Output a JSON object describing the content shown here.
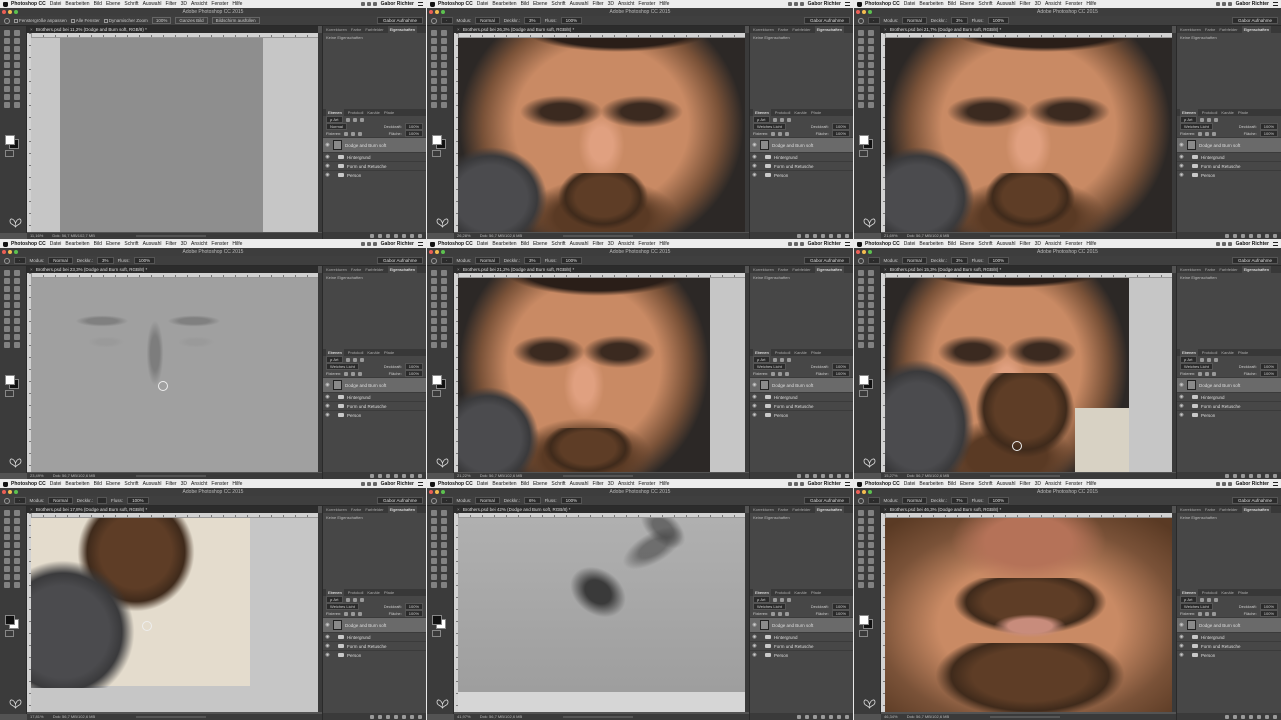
{
  "menubar": {
    "app": "Photoshop CC",
    "items": [
      "Datei",
      "Bearbeiten",
      "Bild",
      "Ebene",
      "Schrift",
      "Auswahl",
      "Filter",
      "3D",
      "Ansicht",
      "Fenster",
      "Hilfe"
    ],
    "user": "Gabor Richter"
  },
  "window_title": "Adobe Photoshop CC 2015",
  "options_move": {
    "fit": "Fenstergröße anpassen",
    "all_windows": "Alle Fenster",
    "scrubby": "Dynamischer Zoom",
    "zoom": "100%",
    "full": "Ganzes Bild",
    "fill": "Bildschirm ausfüllen"
  },
  "options_brush": {
    "mode_label": "Modus:",
    "mode": "Normal",
    "opacity_label": "Deckkr.:",
    "flow_label": "Fluss:",
    "flow": "100%"
  },
  "workspace": "Gabor Aufnahme",
  "panel_tabs": [
    "Korrekturen",
    "Farbe",
    "Farbfelder",
    "Eigenschaften"
  ],
  "properties_empty": "Keine Eigenschaften",
  "layer_tabs": [
    "Ebenen",
    "Protokoll",
    "Kanäle",
    "Pfade"
  ],
  "layer_controls": {
    "kind": "Art",
    "opacity_label": "Deckkraft:",
    "opacity": "100%",
    "lock_label": "Fixieren:",
    "fill_label": "Fläche:",
    "fill": "100%"
  },
  "layers": [
    "Dodge and Burn soft",
    "Hintergrund",
    "Form und Retusche",
    "Person"
  ],
  "panes": [
    {
      "doc": "Brothers.psd bei 11,2% (Dodge and Burn soft, RGB/8) *",
      "zoom": "11,16%",
      "blend": "Normal",
      "opacity": "",
      "doc_info": "Dok: 56,7 MB/102,7 MB"
    },
    {
      "doc": "Brothers.psd bei 26,3% (Dodge and Burn soft, RGB/8) *",
      "zoom": "26,28%",
      "blend": "Weiches Licht",
      "opacity": "3%",
      "doc_info": "Dok: 56,7 MB/102,6 MB"
    },
    {
      "doc": "Brothers.psd bei 21,7% (Dodge and Burn soft, RGB/8) *",
      "zoom": "21,69%",
      "blend": "Weiches Licht",
      "opacity": "3%",
      "doc_info": "Dok: 56,7 MB/102,6 MB"
    },
    {
      "doc": "Brothers.psd bei 23,3% (Dodge and Burn soft, RGB/8) *",
      "zoom": "23,49%",
      "blend": "Weiches Licht",
      "opacity": "3%",
      "doc_info": "Dok: 56,7 MB/102,6 MB"
    },
    {
      "doc": "Brothers.psd bei 21,2% (Dodge and Burn soft, RGB/8) *",
      "zoom": "21,22%",
      "blend": "Weiches Licht",
      "opacity": "3%",
      "doc_info": "Dok: 56,7 MB/102,6 MB"
    },
    {
      "doc": "Brothers.psd bei 15,3% (Dodge and Burn soft, RGB/8) *",
      "zoom": "15,27%",
      "blend": "Weiches Licht",
      "opacity": "3%",
      "doc_info": "Dok: 56,7 MB/102,6 MB"
    },
    {
      "doc": "Brothers.psd bei 17,8% (Dodge and Burn soft, RGB/8) *",
      "zoom": "17,81%",
      "blend": "Weiches Licht",
      "opacity": "",
      "doc_info": "Dok: 56,7 MB/102,6 MB"
    },
    {
      "doc": "Brothers.psd bei 42% (Dodge and Burn soft, RGB/8) *",
      "zoom": "41,97%",
      "blend": "Weiches Licht",
      "opacity": "6%",
      "doc_info": "Dok: 56,7 MB/102,6 MB"
    },
    {
      "doc": "Brothers.psd bei 46,3% (Dodge and Burn soft, RGB/8) *",
      "zoom": "46,34%",
      "blend": "Weiches Licht",
      "opacity": "7%",
      "doc_info": "Dok: 56,7 MB/102,6 MB"
    }
  ]
}
